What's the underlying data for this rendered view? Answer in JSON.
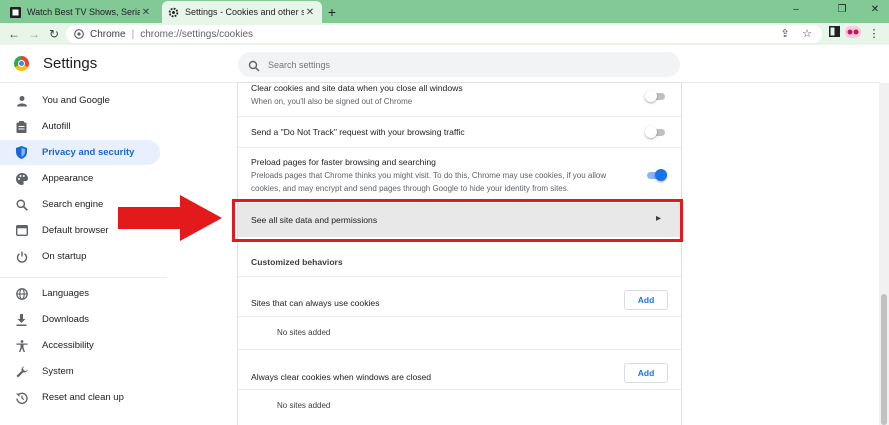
{
  "colors": {
    "tab_strip": "#81c995",
    "toolbar": "#e8f5e9",
    "accent": "#1a73e8",
    "active_nav_bg": "#e8f0fe",
    "annotation_red": "#e3191c"
  },
  "tabs": [
    {
      "title": "Watch Best TV Shows, Serials, Sp",
      "icon": "tv-site-icon",
      "close": "✕"
    },
    {
      "title": "Settings - Cookies and other site",
      "icon": "gear-icon",
      "close": "✕"
    }
  ],
  "new_tab": "+",
  "window_controls": {
    "minimize": "–",
    "restore": "❐",
    "close": "✕"
  },
  "toolbar": {
    "back": "←",
    "forward": "→",
    "reload": "↻",
    "omnibox_label": "Chrome",
    "omnibox_separator": "|",
    "url": "chrome://settings/cookies",
    "share": "⇪",
    "bookmark": "☆",
    "menu": "⋮"
  },
  "settings": {
    "title": "Settings",
    "search_placeholder": "Search settings"
  },
  "sidebar": {
    "items": [
      {
        "label": "You and Google",
        "icon": "person-icon",
        "active": false
      },
      {
        "label": "Autofill",
        "icon": "clipboard-icon",
        "active": false
      },
      {
        "label": "Privacy and security",
        "icon": "shield-icon",
        "active": true
      },
      {
        "label": "Appearance",
        "icon": "palette-icon",
        "active": false
      },
      {
        "label": "Search engine",
        "icon": "search-icon",
        "active": false
      },
      {
        "label": "Default browser",
        "icon": "browser-icon",
        "active": false
      },
      {
        "label": "On startup",
        "icon": "power-icon",
        "active": false
      },
      {
        "label": "Languages",
        "icon": "globe-icon",
        "active": false
      },
      {
        "label": "Downloads",
        "icon": "download-icon",
        "active": false
      },
      {
        "label": "Accessibility",
        "icon": "accessibility-icon",
        "active": false
      },
      {
        "label": "System",
        "icon": "wrench-icon",
        "active": false
      },
      {
        "label": "Reset and clean up",
        "icon": "history-icon",
        "active": false
      }
    ]
  },
  "main": {
    "clear_on_exit": {
      "title": "Clear cookies and site data when you close all windows",
      "subtitle": "When on, you'll also be signed out of Chrome",
      "enabled": false
    },
    "do_not_track": {
      "title": "Send a \"Do Not Track\" request with your browsing traffic",
      "enabled": false
    },
    "preload": {
      "title": "Preload pages for faster browsing and searching",
      "subtitle_line1": "Preloads pages that Chrome thinks you might visit. To do this, Chrome may use cookies, if you allow",
      "subtitle_line2": "cookies, and may encrypt and send pages through Google to hide your identity from sites.",
      "enabled": true
    },
    "see_all": {
      "title": "See all site data and permissions",
      "chevron": "▸"
    },
    "customized_behaviors": "Customized behaviors",
    "always_use": {
      "title": "Sites that can always use cookies",
      "button": "Add",
      "empty": "No sites added"
    },
    "always_clear": {
      "title": "Always clear cookies when windows are closed",
      "button": "Add",
      "empty": "No sites added"
    }
  }
}
